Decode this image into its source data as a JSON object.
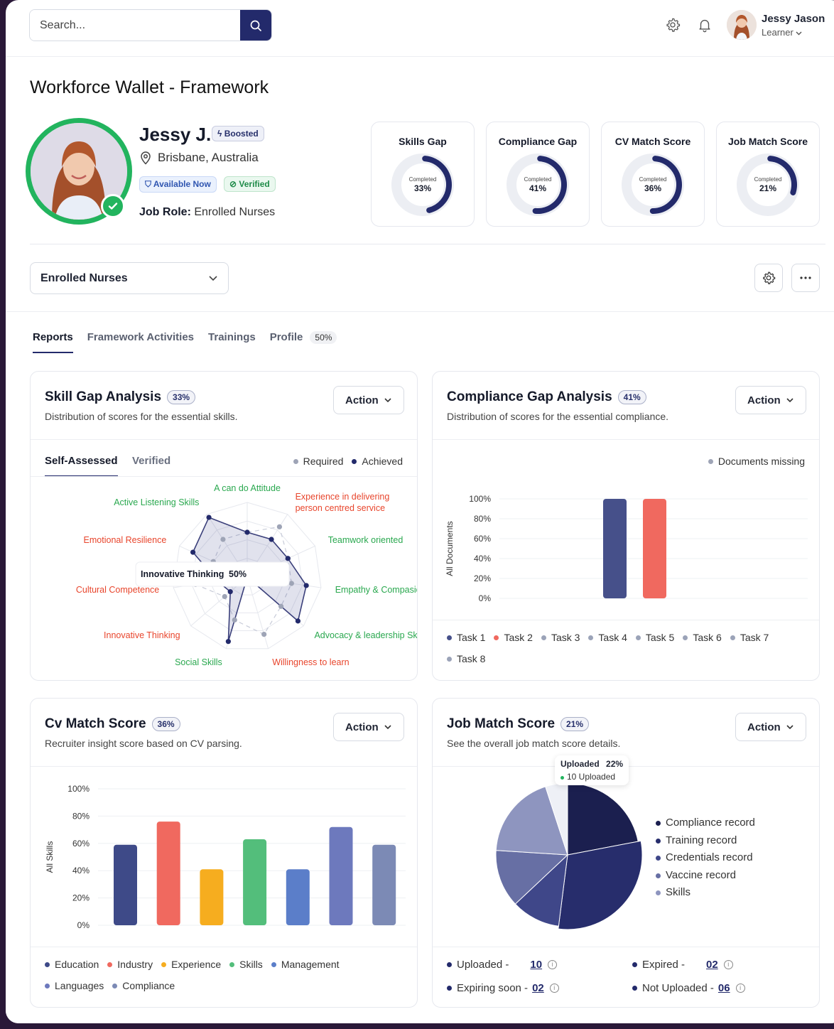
{
  "header": {
    "search_placeholder": "Search...",
    "user_name": "Jessy Jason",
    "user_role": "Learner"
  },
  "page": {
    "title": "Workforce Wallet - Framework"
  },
  "profile": {
    "name": "Jessy J.",
    "boost_label": "Boosted",
    "location": "Brisbane, Australia",
    "available_label": "Available Now",
    "verified_label": "Verified",
    "job_role_label": "Job Role:",
    "job_role_value": "Enrolled Nurses"
  },
  "score_cards": [
    {
      "title": "Skills Gap",
      "caption": "Completed",
      "value": "33%",
      "pct": 33
    },
    {
      "title": "Compliance Gap",
      "caption": "Completed",
      "value": "41%",
      "pct": 41
    },
    {
      "title": "CV Match Score",
      "caption": "Completed",
      "value": "36%",
      "pct": 36
    },
    {
      "title": "Job Match Score",
      "caption": "Completed",
      "value": "21%",
      "pct": 21
    }
  ],
  "role_select": {
    "value": "Enrolled Nurses"
  },
  "tabs": [
    {
      "label": "Reports"
    },
    {
      "label": "Framework Activities"
    },
    {
      "label": "Trainings"
    },
    {
      "label": "Profile"
    }
  ],
  "profile_tab_pct": "50%",
  "cards": {
    "skill": {
      "title": "Skill Gap Analysis",
      "pct": "33%",
      "subtitle": "Distribution of scores for the essential skills.",
      "action": "Action",
      "subtab1": "Self-Assessed",
      "subtab2": "Verified",
      "legend_required": "Required",
      "legend_achieved": "Achieved",
      "tooltip_label": "Innovative Thinking",
      "tooltip_value": "50%"
    },
    "compliance": {
      "title": "Compliance Gap Analysis",
      "pct": "41%",
      "subtitle": "Distribution of scores for the essential compliance.",
      "action": "Action",
      "legend_missing": "Documents missing"
    },
    "cv": {
      "title": "Cv Match Score",
      "pct": "36%",
      "subtitle": "Recruiter insight score based on CV parsing.",
      "action": "Action"
    },
    "job": {
      "title": "Job Match Score",
      "pct": "21%",
      "subtitle": "See the overall job match score details.",
      "action": "Action",
      "tooltip_label": "Uploaded",
      "tooltip_value": "22%",
      "tooltip_sub": "10 Uploaded",
      "stats": [
        {
          "label": "Uploaded -",
          "value": "10"
        },
        {
          "label": "Expired -",
          "value": "02"
        },
        {
          "label": "Expiring soon -",
          "value": "02"
        },
        {
          "label": "Not Uploaded -",
          "value": "06"
        }
      ]
    }
  },
  "colors": {
    "navy": "#232a6b",
    "green": "#22b45e",
    "red_text": "#e8452c",
    "green_text": "#2aa84f"
  },
  "chart_data": [
    {
      "type": "radar",
      "axes": [
        "A can do Attitude",
        "Experience in delivering person centred service",
        "Teamwork oriented",
        "Empathy & Compasion",
        "Advocacy & leadership Skills",
        "Willingness to learn",
        "Social Skills",
        "Innovative Thinking",
        "Cultural Competence",
        "Emotional Resilience",
        "Active Listening Skills"
      ],
      "axis_status": [
        "met",
        "gap",
        "met",
        "met",
        "met",
        "gap",
        "met",
        "gap",
        "gap",
        "gap",
        "met"
      ],
      "series": [
        {
          "name": "Required",
          "values": [
            0.6,
            0.8,
            0.6,
            0.6,
            0.6,
            0.8,
            0.6,
            0.4,
            0.7,
            0.5,
            0.6
          ]
        },
        {
          "name": "Achieved",
          "values": [
            0.6,
            0.6,
            0.6,
            0.8,
            0.9,
            0.0,
            0.9,
            0.3,
            0.4,
            0.8,
            0.95
          ]
        }
      ]
    },
    {
      "type": "bar",
      "ylabel": "All Documents",
      "yticks": [
        "100%",
        "80%",
        "60%",
        "40%",
        "20%",
        "0%"
      ],
      "ylim": [
        0,
        100
      ],
      "categories": [
        "Task 1",
        "Task 2",
        "Task 3",
        "Task 4",
        "Task 5",
        "Task 6",
        "Task 7",
        "Task 8"
      ],
      "values": [
        100,
        100,
        0,
        0,
        0,
        0,
        0,
        0
      ],
      "colors": [
        "#46508a",
        "#f0695f",
        "#9ba3b8",
        "#9ba3b8",
        "#9ba3b8",
        "#9ba3b8",
        "#9ba3b8",
        "#9ba3b8"
      ],
      "legend_placement": "bottom"
    },
    {
      "type": "bar",
      "ylabel": "All Skills",
      "yticks": [
        "100%",
        "80%",
        "60%",
        "40%",
        "20%",
        "0%"
      ],
      "ylim": [
        0,
        100
      ],
      "categories": [
        "Education",
        "Industry",
        "Experience",
        "Skills",
        "Management",
        "Languages",
        "Compliance"
      ],
      "bars": [
        {
          "label": "Education",
          "value": 59,
          "color": "#3e4a88"
        },
        {
          "label": "Industry",
          "value": 76,
          "color": "#f0695f"
        },
        {
          "label": "Experience",
          "value": 41,
          "color": "#f6ad1f"
        },
        {
          "label": "Skills",
          "value": 63,
          "color": "#53be7b"
        },
        {
          "label": "Management",
          "value": 41,
          "color": "#5b7ec9"
        },
        {
          "label": "Languages",
          "value": 72,
          "color": "#6d79bd"
        },
        {
          "label": "Compliance",
          "value": 59,
          "color": "#7c8ab5"
        }
      ],
      "legend_placement": "bottom"
    },
    {
      "type": "pie",
      "slices": [
        {
          "label": "Compliance record",
          "value": 22,
          "color": "#1b1f4f"
        },
        {
          "label": "Training record",
          "value": 30,
          "color": "#272d6c"
        },
        {
          "label": "Credentials record",
          "value": 11,
          "color": "#3f4789"
        },
        {
          "label": "Vaccine record",
          "value": 13,
          "color": "#676fa4"
        },
        {
          "label": "Skills",
          "value": 19,
          "color": "#8e95bf"
        },
        {
          "label": "",
          "value": 5,
          "color": "#eef0f6"
        }
      ],
      "legend_placement": "right"
    }
  ]
}
